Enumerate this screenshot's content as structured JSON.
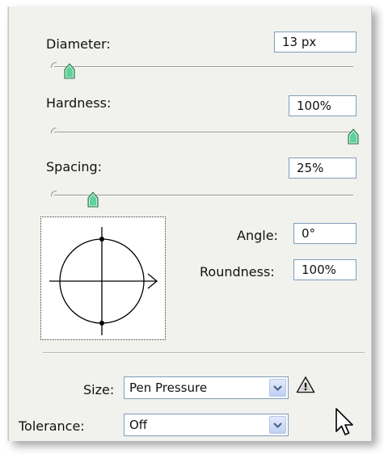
{
  "brush": {
    "diameter": {
      "label": "Diameter:",
      "value": "13 px",
      "slider_fraction": 0.05
    },
    "hardness": {
      "label": "Hardness:",
      "value": "100%",
      "slider_fraction": 1.0
    },
    "spacing": {
      "label": "Spacing:",
      "value": "25%",
      "slider_fraction": 0.13
    }
  },
  "tip": {
    "angle": {
      "label": "Angle:",
      "value": "0°"
    },
    "roundness": {
      "label": "Roundness:",
      "value": "100%"
    }
  },
  "controls": {
    "size": {
      "label": "Size:",
      "value": "Pen Pressure",
      "warning_icon": "warning-triangle-icon"
    },
    "tolerance": {
      "label": "Tolerance:",
      "value": "Off"
    }
  },
  "colors": {
    "panel": "#f1f1ee",
    "field_border": "#7f9db9",
    "thumb": "#5fd19a"
  },
  "icons": [
    "slider-thumb-icon",
    "chevron-down-icon",
    "warning-triangle-icon",
    "mouse-cursor-icon"
  ]
}
